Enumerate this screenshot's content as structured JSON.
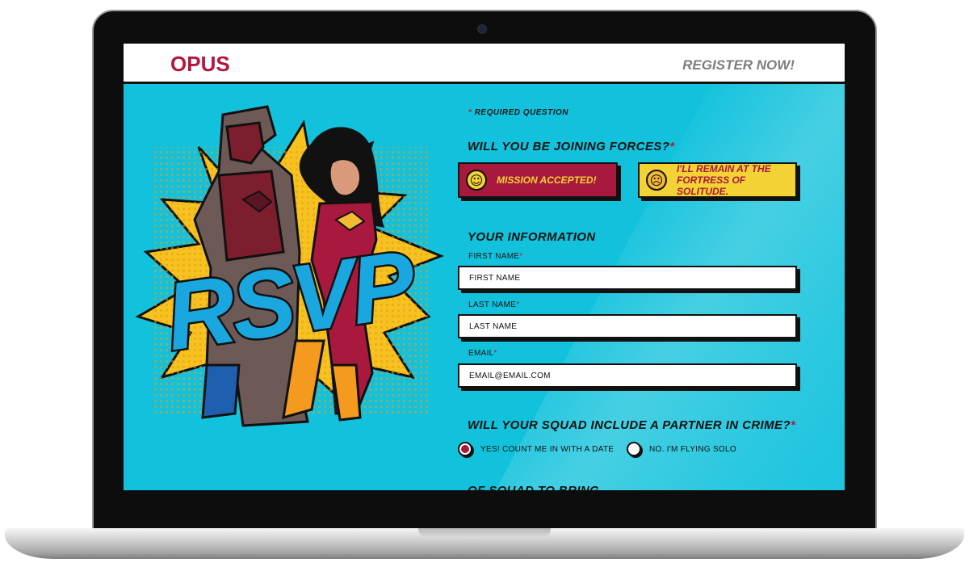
{
  "header": {
    "logo": "OPUS",
    "register": "REGISTER NOW!"
  },
  "hero": {
    "title": "RSVP"
  },
  "form": {
    "required_note": "REQUIRED QUESTION",
    "required_marker": "*",
    "joining": {
      "question": "WILL YOU BE JOINING FORCES?",
      "accept_label": "MISSION ACCEPTED!",
      "decline_label": "I'LL REMAIN AT THE FORTRESS OF SOLITUDE."
    },
    "info": {
      "heading": "YOUR INFORMATION",
      "first_name_label": "FIRST NAME",
      "first_name_placeholder": "FIRST NAME",
      "last_name_label": "LAST NAME",
      "last_name_placeholder": "LAST NAME",
      "email_label": "EMAIL",
      "email_placeholder": "EMAIL@EMAIL.COM"
    },
    "partner": {
      "question": "WILL YOUR SQUAD INCLUDE A PARTNER IN CRIME?",
      "options": [
        {
          "label": "YES! COUNT ME IN WITH A DATE",
          "selected": true
        },
        {
          "label": "NO. I'M FLYING SOLO",
          "selected": false
        }
      ]
    },
    "next_heading": "OF SQUAD TO BRING"
  },
  "colors": {
    "background": "#12c2dc",
    "brand_red": "#a8193d",
    "brand_yellow": "#f3d235",
    "logo_red": "#b5163f"
  }
}
